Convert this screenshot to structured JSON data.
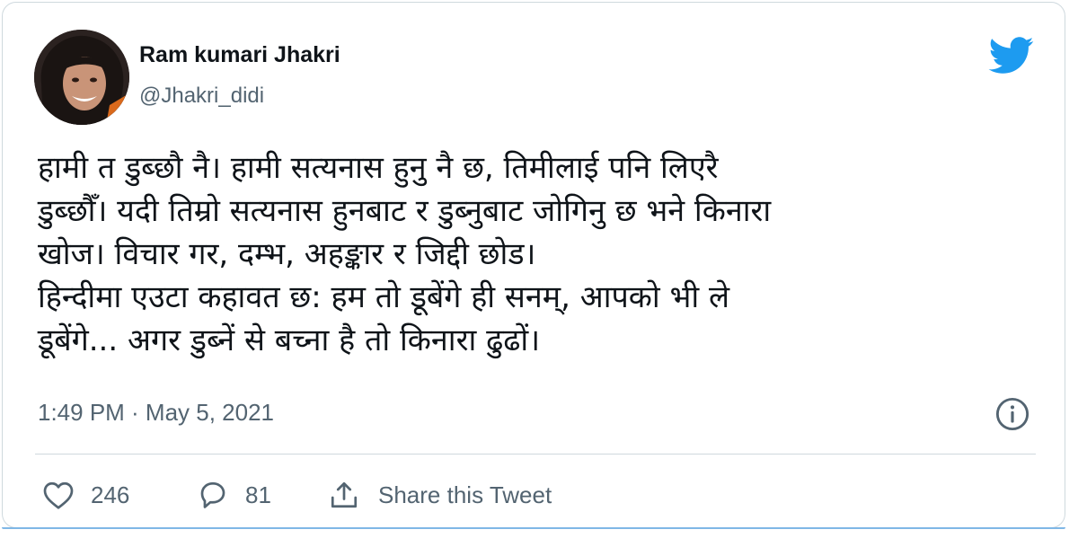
{
  "author": {
    "name": "Ram kumari Jhakri",
    "handle": "@Jhakri_didi"
  },
  "icons": {
    "brand": "twitter-bird-icon",
    "info": "info-icon",
    "like": "heart-icon",
    "reply": "reply-icon",
    "share": "share-icon"
  },
  "colors": {
    "brand_blue": "#1d9bf0",
    "secondary_text": "#536471",
    "border": "#cfd9de"
  },
  "tweet": {
    "lines": [
      "हामी त डुब्छौ नै। हामी सत्यनास हुनु नै छ, तिमीलाई पनि लिएरै",
      "डुब्छौँ। यदी तिम्रो सत्यनास हुनबाट र डुब्नुबाट जोगिनु छ भने किनारा",
      "खोज। विचार गर, दम्भ, अहङ्कार र जिद्दी छोड।",
      "हिन्दीमा एउटा कहावत छ: हम तो डूबेंगे ही सनम्, आपको भी ले",
      "डूबेंगे... अगर डुब्नें से बच्ना है तो किनारा ढुढों।"
    ],
    "timestamp": "1:49 PM · May 5, 2021"
  },
  "actions": {
    "likes": "246",
    "replies": "81",
    "share_label": "Share this Tweet"
  }
}
